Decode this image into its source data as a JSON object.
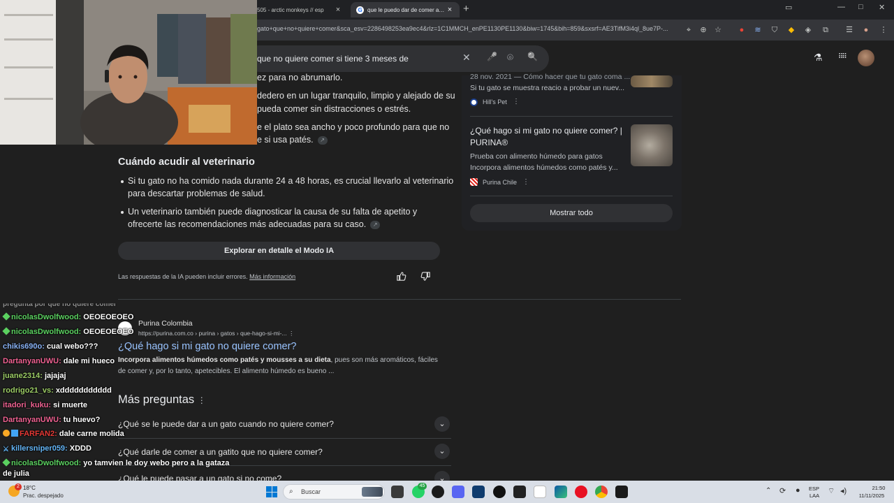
{
  "tabs": [
    {
      "title": "505 - arctic monkeys // esp",
      "close": "×"
    },
    {
      "title": "que le puedo dar de comer a mi",
      "close": "×",
      "favicon": "G"
    }
  ],
  "new_tab": "+",
  "window_controls": {
    "minimize": "—",
    "maximize": "□",
    "close": "✕"
  },
  "address_bar": {
    "url": "gato+que+no+quiere+comer&sca_esv=2286498253ea9ec4&rlz=1C1MMCH_enPE1130PE1130&biw=1745&bih=859&sxsrf=AE3TifM3i4ql_8ue7P-..."
  },
  "search": {
    "query": "que no quiere comer si tiene 3 meses de",
    "clear": "✕",
    "mic": "🎤",
    "lens": "⌾",
    "search": "🔍"
  },
  "header_right": {
    "labs": "⚗",
    "apps": "⋮⋮⋮"
  },
  "ai_overview": {
    "partial_lines": [
      "ez para no abrumarlo.",
      "dedero en un lugar tranquilo, limpio y alejado de su",
      "pueda comer sin distracciones o estrés.",
      "e el plato sea ancho y poco profundo para que no",
      "e si usa patés."
    ],
    "vet_heading": "Cuándo acudir al veterinario",
    "vet_bullets": [
      [
        "Si tu gato no ha comido nada durante 24 a 48 horas, es crucial llevarlo al veterinario",
        "para descartar problemas de salud."
      ],
      [
        "Un veterinario también puede diagnosticar la causa de su falta de apetito y",
        "ofrecerte las recomendaciones más adecuadas para su caso."
      ]
    ],
    "explore_button": "Explorar en detalle el Modo IA",
    "disclaimer": "Las respuestas de la IA pueden incluir errores.",
    "learn_more": "Más información",
    "thumbs_up": "👍",
    "thumbs_down": "👎",
    "link_chip": "🔗"
  },
  "sources": {
    "items": [
      {
        "title": "",
        "snippet_1": "28 nov. 2021 — Cómo hacer que tu gato coma ...",
        "snippet_2": "Si tu gato se muestra reacio a probar un nuev...",
        "site": "Hill's Pet"
      },
      {
        "title_1": "¿Qué hago si mi gato no quiere comer? |",
        "title_2": "PURINA®",
        "snippet_1": "Prueba con alimento húmedo para gatos",
        "snippet_2": "Incorpora alimentos húmedos como patés y...",
        "site": "Purina Chile"
      }
    ],
    "more": "⋮",
    "show_all": "Mostrar todo"
  },
  "organic": {
    "site": "Purina Colombia",
    "url": "https://purina.com.co › purina › gatos › que-hago-si-mi-...",
    "title": "¿Qué hago si mi gato no quiere comer?",
    "snippet_bold": "Incorpora alimentos húmedos como patés y mousses a su dieta",
    "snippet_rest": ", pues son más aromáticos, fáciles",
    "snippet_2": "de comer y, por lo tanto, apetecibles. El alimento húmedo es bueno ..."
  },
  "more_questions": {
    "heading": "Más preguntas",
    "items": [
      "¿Qué se le puede dar a un gato cuando no quiere comer?",
      "¿Qué darle de comer a un gatito que no quiere comer?",
      "¿Qué le puede pasar a un gato si no come?"
    ],
    "chevron": "⌄"
  },
  "chat": [
    {
      "user": "nicolasDwolfwood:",
      "msg": "OEOEOEOEO",
      "color": "#5bd160"
    },
    {
      "user": "chikis690o:",
      "msg": "cual webo???",
      "color": "#8ab4f8"
    },
    {
      "user": "DartanyanUWU:",
      "msg": "dale mi hueco",
      "color": "#f06292"
    },
    {
      "user": "juane2314:",
      "msg": "jajajaj",
      "color": "#9ccc65"
    },
    {
      "user": "rodrigo21_vs:",
      "msg": "xddddddddddd",
      "color": "#9ccc65"
    },
    {
      "user": "itadori_kuku:",
      "msg": "si muerte",
      "color": "#f06292"
    },
    {
      "user": "DartanyanUWU:",
      "msg": "tu huevo?",
      "color": "#f06292"
    },
    {
      "user": "FARFAN2:",
      "msg": "dale carne molida",
      "color": "#e53935"
    },
    {
      "user": "killersniper059:",
      "msg": "XDDD",
      "color": "#64b5f6"
    },
    {
      "user": "nicolasDwolfwood:",
      "msg": "yo tamvien le doy webo pero a la gataza",
      "color": "#5bd160"
    },
    {
      "user": "",
      "msg": "de julia",
      "color": "#ffffff"
    }
  ],
  "taskbar": {
    "weather_temp": "18°C",
    "weather_desc": "Prac. despejado",
    "search_label": "Buscar",
    "lang_1": "ESP",
    "lang_2": "LAA",
    "time": "21:50",
    "date": "11/11/2025",
    "whatsapp_badge": "45",
    "weather_badge": "2"
  }
}
